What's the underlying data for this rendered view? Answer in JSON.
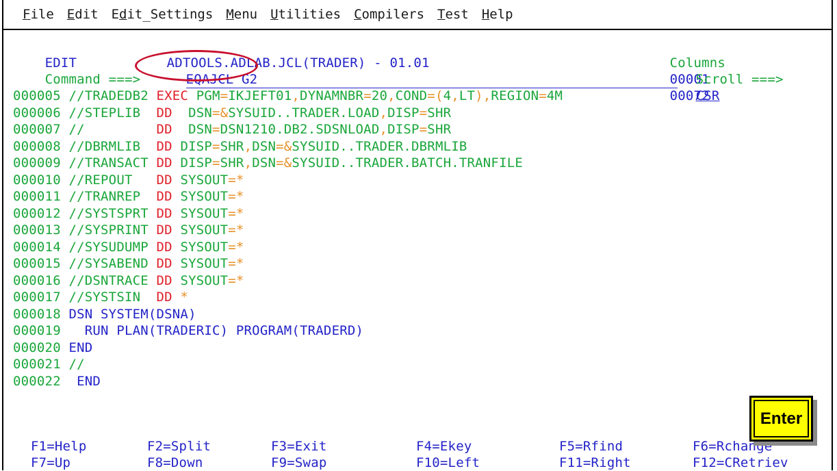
{
  "menu": [
    {
      "label": "File",
      "u": "F",
      "rest": "ile"
    },
    {
      "label": "Edit",
      "u": "E",
      "rest": "dit"
    },
    {
      "label": "Edit_Settings",
      "pre": "E",
      "u": "d",
      "rest": "it_Settings"
    },
    {
      "label": "Menu",
      "u": "M",
      "rest": "enu"
    },
    {
      "label": "Utilities",
      "u": "U",
      "rest": "tilities"
    },
    {
      "label": "Compilers",
      "u": "C",
      "rest": "ompilers"
    },
    {
      "label": "Test",
      "u": "T",
      "rest": "est"
    },
    {
      "label": "Help",
      "u": "H",
      "rest": "elp"
    }
  ],
  "header": {
    "mode": "EDIT",
    "dataset": "ADTOOLS.ADLAB.JCL(TRADER) - 01.01",
    "columns_label": "Columns",
    "columns_from": "00001",
    "columns_to": "00072",
    "command_label": "Command ===>",
    "command_value": "EQAJCL G2",
    "scroll_label": "Scroll ===>",
    "scroll_value": "CSR"
  },
  "lines": [
    {
      "num": "000005",
      "text": " //TRADEDB2 EXEC PGM=IKJEFT01,DYNAMNBR=20,COND=(4,LT),REGION=4M"
    },
    {
      "num": "000006",
      "text": " //STEPLIB  DD  DSN=&SYSUID..TRADER.LOAD,DISP=SHR"
    },
    {
      "num": "000007",
      "text": " //         DD  DSN=DSN1210.DB2.SDSNLOAD,DISP=SHR"
    },
    {
      "num": "000008",
      "text": " //DBRMLIB  DD DISP=SHR,DSN=&SYSUID..TRADER.DBRMLIB"
    },
    {
      "num": "000009",
      "text": " //TRANSACT DD DISP=SHR,DSN=&SYSUID..TRADER.BATCH.TRANFILE"
    },
    {
      "num": "000010",
      "text": " //REPOUT   DD SYSOUT=*"
    },
    {
      "num": "000011",
      "text": " //TRANREP  DD SYSOUT=*"
    },
    {
      "num": "000012",
      "text": " //SYSTSPRT DD SYSOUT=*"
    },
    {
      "num": "000013",
      "text": " //SYSPRINT DD SYSOUT=*"
    },
    {
      "num": "000014",
      "text": " //SYSUDUMP DD SYSOUT=*"
    },
    {
      "num": "000015",
      "text": " //SYSABEND DD SYSOUT=*"
    },
    {
      "num": "000016",
      "text": " //DSNTRACE DD SYSOUT=*"
    },
    {
      "num": "000017",
      "text": " //SYSTSIN  DD *"
    },
    {
      "num": "000018",
      "text": " DSN SYSTEM(DSNA)"
    },
    {
      "num": "000019",
      "text": "   RUN PLAN(TRADERIC) PROGRAM(TRADERD)"
    },
    {
      "num": "000020",
      "text": " END"
    },
    {
      "num": "000021",
      "text": " //"
    },
    {
      "num": "000022",
      "text": "  END"
    }
  ],
  "fkeys_row1": [
    "F1=Help",
    "F2=Split",
    "F3=Exit",
    "F4=Ekey",
    "F5=Rfind",
    "F6=Rchange"
  ],
  "fkeys_row2": [
    "F7=Up",
    "F8=Down",
    "F9=Swap",
    "F10=Left",
    "F11=Right",
    "F12=CRetriev"
  ],
  "enter_button": "Enter",
  "colors": {
    "blue": "#2323c8",
    "green": "#1aa63a",
    "red": "#e0202a",
    "orange": "#e6912a",
    "highlight_oval": "#c8102e",
    "enter_bg": "#ffff00"
  }
}
